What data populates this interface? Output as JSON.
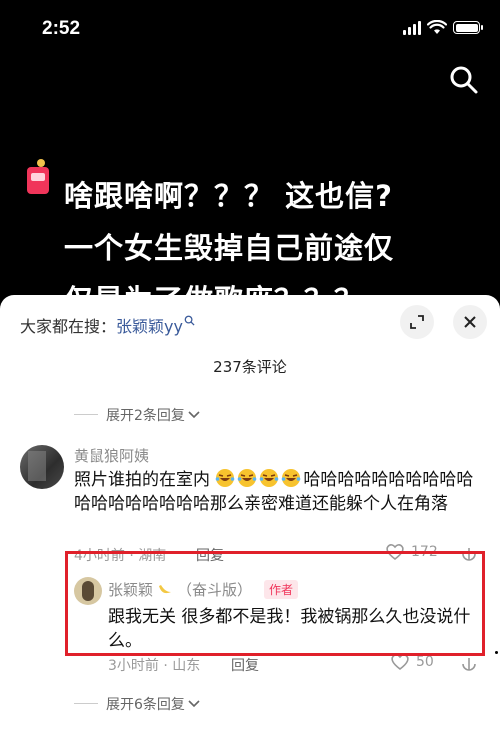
{
  "status_bar": {
    "time": "2:52"
  },
  "video": {
    "caption_lines": [
      "啥跟啥啊？？？ 这也信?",
      "一个女生毁掉自己前途仅",
      "仅是为了做歌座？？？"
    ]
  },
  "sheet": {
    "hot_search_label": "大家都在搜：",
    "hot_search_keyword": "张颖颖yy",
    "comment_count": "237条评论",
    "expand_top": "展开2条回复",
    "expand_bottom": "展开6条回复",
    "comment": {
      "user": "黄鼠狼阿姨",
      "text_before_emoji": "照片谁拍的在室内",
      "emoji_name": "laughing-crying-emoji",
      "text_after_emoji": "哈哈哈哈哈哈哈哈哈哈哈哈哈哈哈哈哈哈那么亲密难道还能躲个人在角落",
      "meta": "4小时前 · 湖南",
      "reply_label": "回复",
      "likes": "172"
    },
    "reply": {
      "user": "张颖颖",
      "user_suffix": "（奋斗版）",
      "badge": "作者",
      "text": "跟我无关 很多都不是我！我被锅那么久也没说什么。",
      "meta": "3小时前 · 山东",
      "reply_label": "回复",
      "likes": "50"
    }
  },
  "colors": {
    "highlight_box": "#e0202a",
    "badge": "#f0355a",
    "keyword": "#3a5a9a"
  }
}
